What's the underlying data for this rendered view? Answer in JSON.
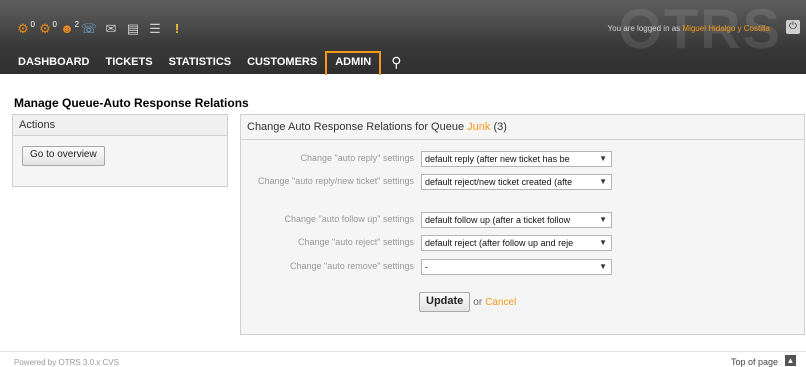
{
  "header": {
    "watermark": "OTRS",
    "login_prefix": "You are logged in as ",
    "user_name": "Miguel Hidalgo y Costilla",
    "toolbar": [
      {
        "icon": "locked-tickets-icon",
        "count": "0"
      },
      {
        "icon": "watched-tickets-icon",
        "count": "0"
      },
      {
        "icon": "responsible-tickets-icon",
        "count": "2"
      },
      {
        "icon": "phone-ticket-icon",
        "count": ""
      },
      {
        "icon": "email-ticket-icon",
        "count": ""
      },
      {
        "icon": "queue-view-icon",
        "count": ""
      },
      {
        "icon": "status-view-icon",
        "count": ""
      },
      {
        "icon": "escalation-view-icon",
        "count": ""
      }
    ]
  },
  "nav": {
    "items": [
      "DASHBOARD",
      "TICKETS",
      "STATISTICS",
      "CUSTOMERS",
      "ADMIN"
    ],
    "active": "ADMIN"
  },
  "page": {
    "title": "Manage Queue-Auto Response Relations"
  },
  "sidebar": {
    "heading": "Actions",
    "overview_button": "Go to overview"
  },
  "main": {
    "heading_prefix": "Change Auto Response Relations for Queue ",
    "queue_name": "Junk",
    "queue_count": "(3)",
    "rows": [
      {
        "label": "Change \"auto reply\" settings",
        "value": "default reply (after new ticket has be"
      },
      {
        "label": "Change \"auto reply/new ticket\" settings",
        "value": "default reject/new ticket created (afte"
      },
      {
        "label": "Change \"auto follow up\" settings",
        "value": "default follow up (after a ticket follow"
      },
      {
        "label": "Change \"auto reject\" settings",
        "value": "default reject (after follow up and reje"
      },
      {
        "label": "Change \"auto remove\" settings",
        "value": "-"
      }
    ],
    "update_button": "Update",
    "or_text": "or",
    "cancel_link": "Cancel"
  },
  "footer": {
    "powered": "Powered by OTRS 3.0.x CVS",
    "top_link": "Top of page"
  },
  "colors": {
    "accent": "#f39a1c",
    "header_bg": "#3a3a3a"
  }
}
